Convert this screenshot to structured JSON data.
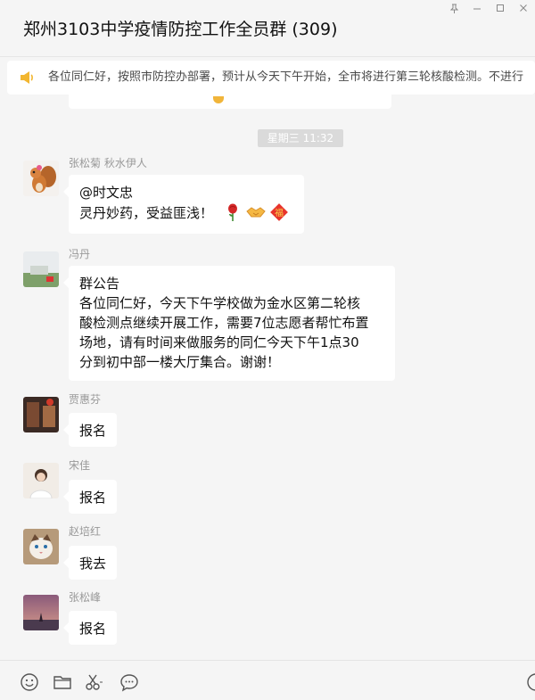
{
  "window": {
    "title": "郑州3103中学疫情防控工作全员群 (309)"
  },
  "notice": {
    "text": "各位同仁好，按照市防控办部署，预计从今天下午开始，全市将进行第三轮核酸检测。不进行"
  },
  "chat": {
    "timestamp": "星期三 11:32",
    "messages": [
      {
        "sender": "张松菊 秋水伊人",
        "lines": [
          "@时文忠",
          "灵丹妙药，受益匪浅！"
        ]
      },
      {
        "sender": "冯丹",
        "lines": [
          "群公告",
          "各位同仁好，今天下午学校做为金水区第二轮核",
          "酸检测点继续开展工作，需要7位志愿者帮忙布置",
          "场地，请有时间来做服务的同仁今天下午1点30",
          "分到初中部一楼大厅集合。谢谢！"
        ]
      },
      {
        "sender": "贾惠芬",
        "lines": [
          "报名"
        ]
      },
      {
        "sender": "宋佳",
        "lines": [
          "报名"
        ]
      },
      {
        "sender": "赵培红",
        "lines": [
          "我去"
        ]
      },
      {
        "sender": "张松峰",
        "lines": [
          "报名"
        ]
      }
    ]
  },
  "icons": {
    "rose": "rose-icon",
    "handshake": "handshake-icon",
    "fu": "fu-icon",
    "emoji": "emoji-icon",
    "folder": "folder-icon",
    "scissors": "scissors-icon",
    "chat": "chat-bubble-icon",
    "pin": "pin-icon",
    "speaker": "speaker-icon"
  },
  "colors": {
    "background": "#f5f5f5",
    "bubble": "#ffffff",
    "sender": "#999999",
    "timestamp_bg": "#dadada",
    "notice_icon": "#f2b630"
  }
}
